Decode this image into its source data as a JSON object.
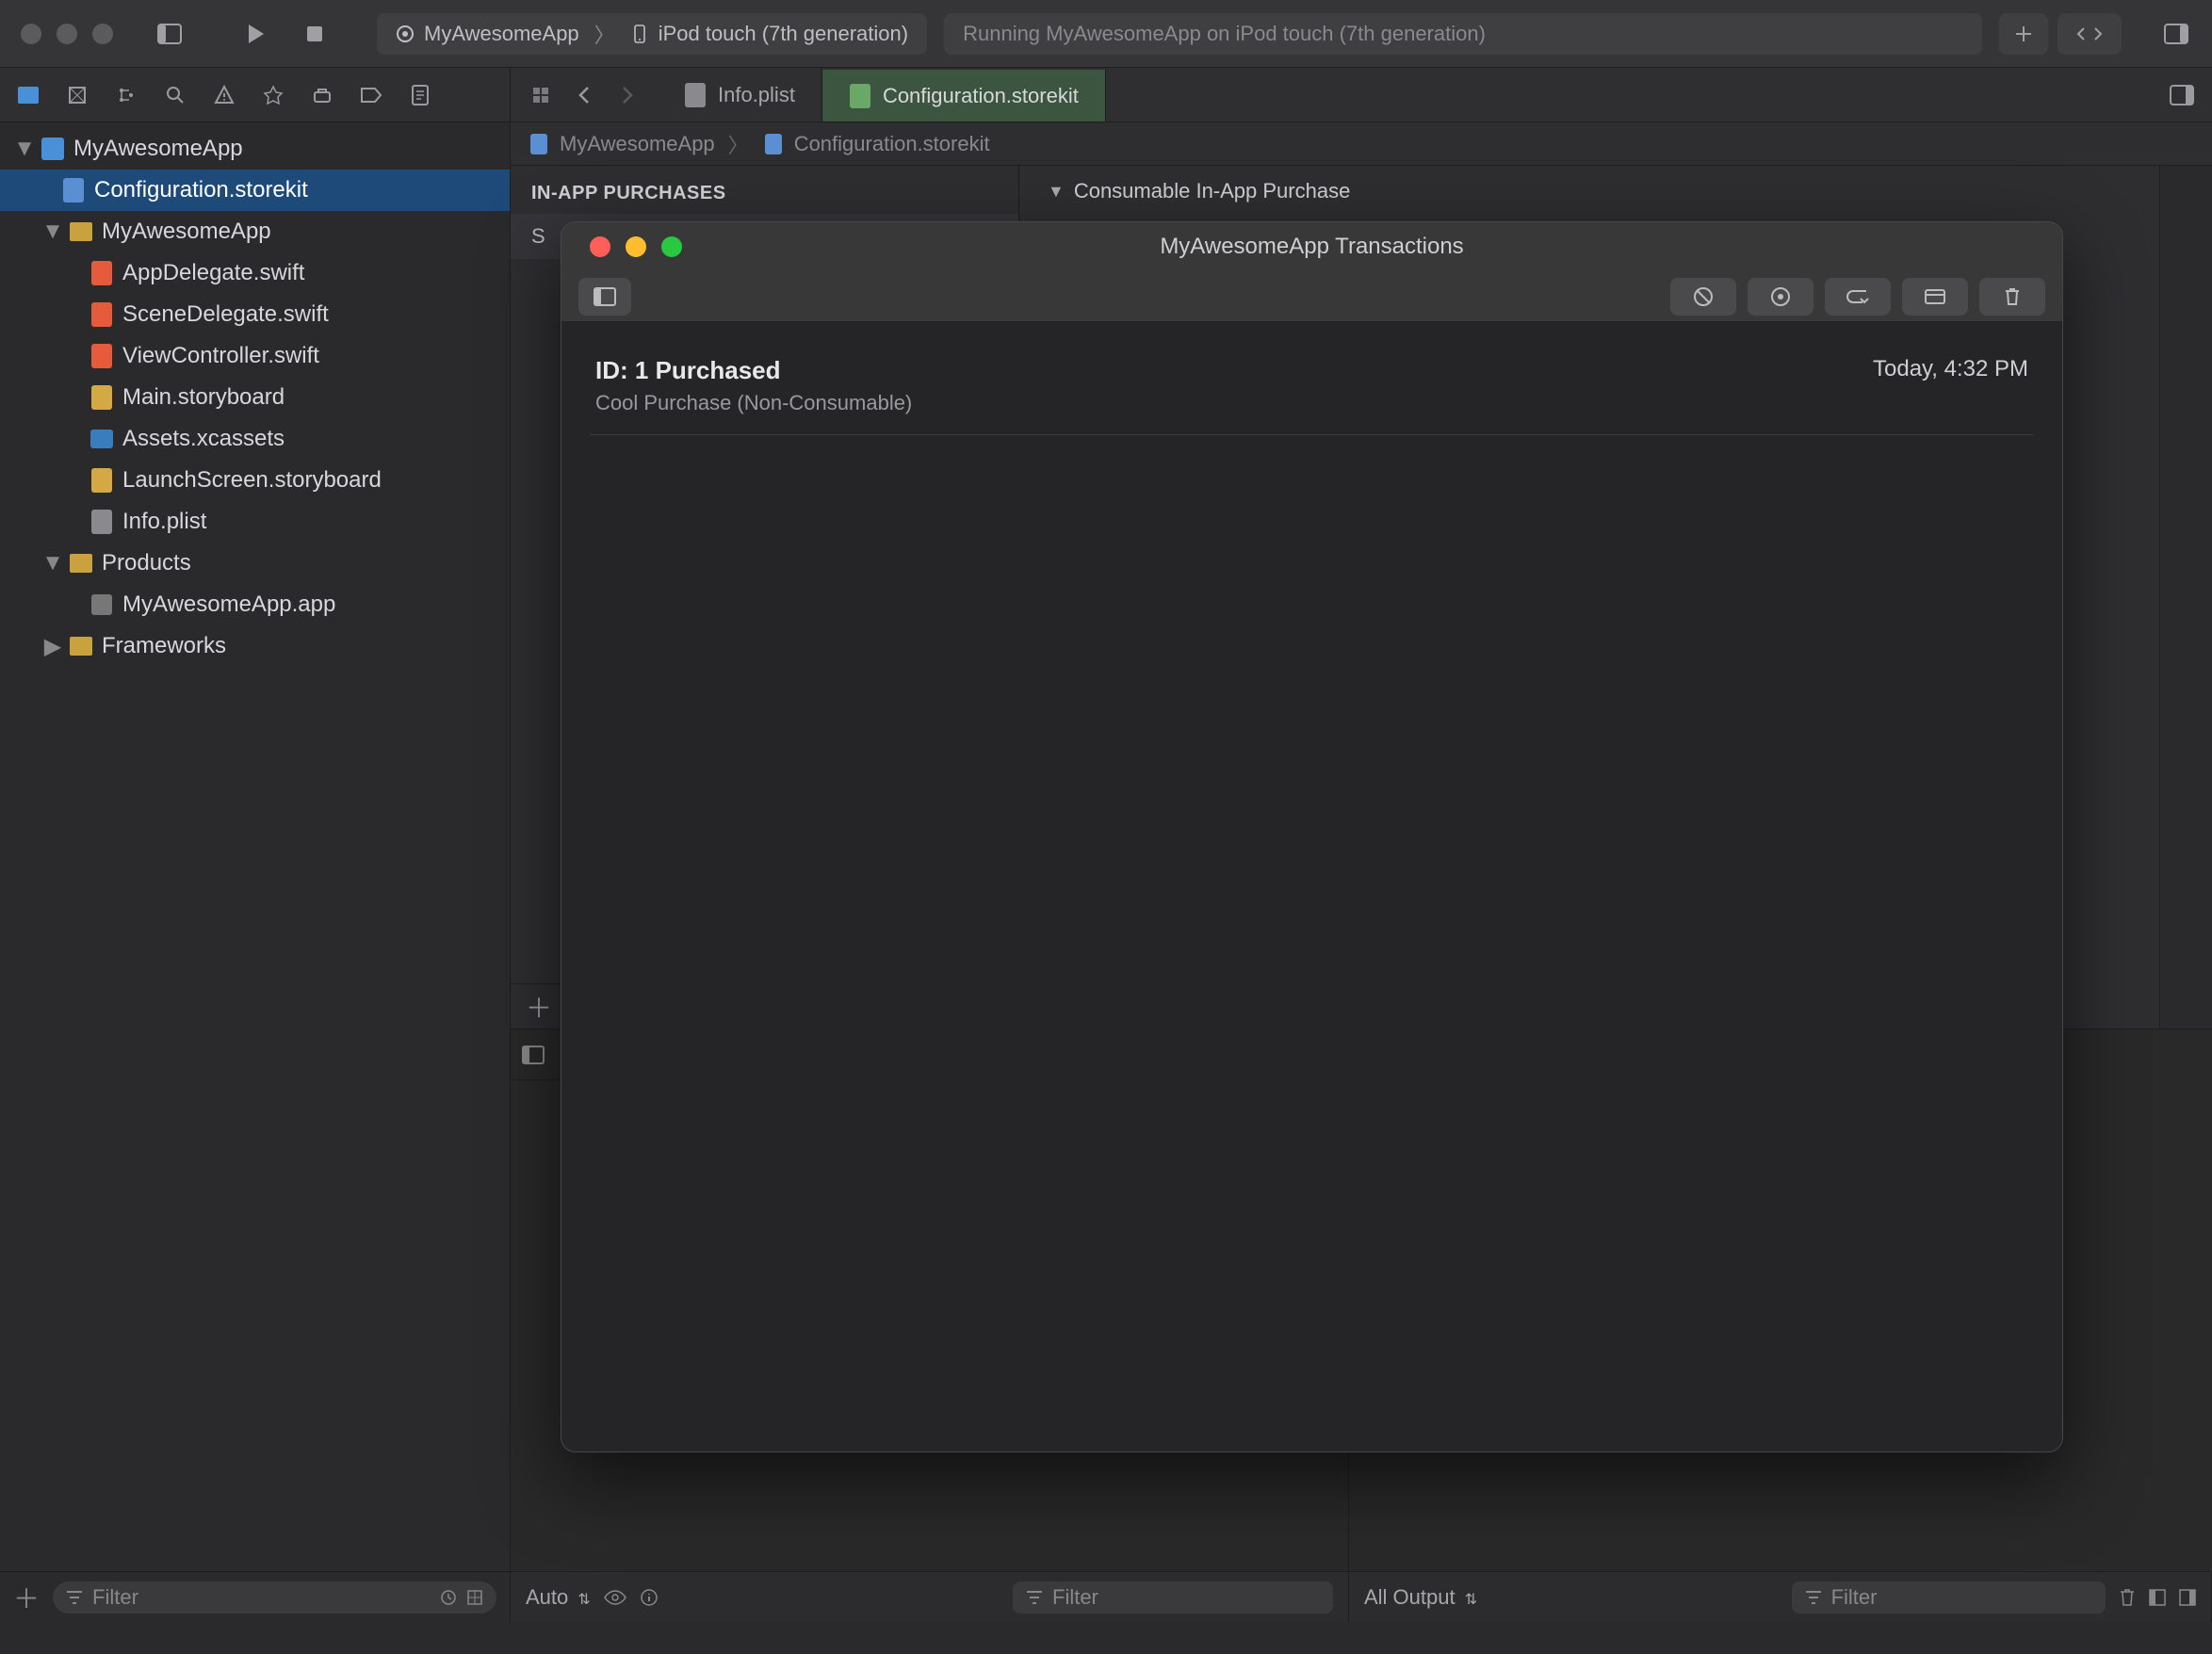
{
  "toolbar": {
    "scheme_app": "MyAwesomeApp",
    "scheme_device": "iPod touch (7th generation)",
    "status_text": "Running MyAwesomeApp on iPod touch (7th generation)"
  },
  "tabs": {
    "tab1": {
      "label": "Info.plist"
    },
    "tab2": {
      "label": "Configuration.storekit"
    }
  },
  "jump_bar": {
    "seg1": "MyAwesomeApp",
    "seg2": "Configuration.storekit"
  },
  "iap_section": {
    "header": "IN-APP PURCHASES",
    "row_visible_label": "S",
    "detail_title": "Consumable In-App Purchase"
  },
  "sidebar": {
    "filter_placeholder": "Filter",
    "project": "MyAwesomeApp",
    "items": [
      {
        "label": "Configuration.storekit",
        "type": "storekit",
        "indent": 1,
        "selected": true
      },
      {
        "label": "MyAwesomeApp",
        "type": "folder",
        "indent": 1,
        "expanded": true
      },
      {
        "label": "AppDelegate.swift",
        "type": "swift",
        "indent": 2
      },
      {
        "label": "SceneDelegate.swift",
        "type": "swift",
        "indent": 2
      },
      {
        "label": "ViewController.swift",
        "type": "swift",
        "indent": 2
      },
      {
        "label": "Main.storyboard",
        "type": "story",
        "indent": 2
      },
      {
        "label": "Assets.xcassets",
        "type": "assets",
        "indent": 2
      },
      {
        "label": "LaunchScreen.storyboard",
        "type": "story",
        "indent": 2
      },
      {
        "label": "Info.plist",
        "type": "plist",
        "indent": 2
      },
      {
        "label": "Products",
        "type": "folder",
        "indent": 1,
        "expanded": true
      },
      {
        "label": "MyAwesomeApp.app",
        "type": "app",
        "indent": 2
      },
      {
        "label": "Frameworks",
        "type": "folder",
        "indent": 1,
        "expanded": false
      }
    ]
  },
  "debug": {
    "auto_label": "Auto",
    "filter_placeholder": "Filter",
    "output_label": "All Output"
  },
  "modal": {
    "title": "MyAwesomeApp Transactions",
    "transaction": {
      "title": "ID: 1 Purchased",
      "subtitle": "Cool Purchase (Non-Consumable)",
      "time": "Today, 4:32 PM"
    }
  }
}
